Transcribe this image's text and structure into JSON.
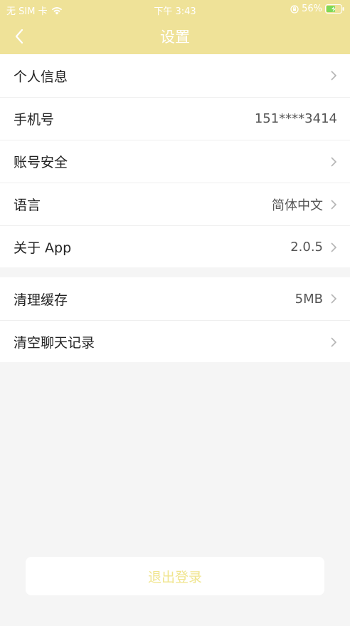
{
  "status": {
    "carrier": "无 SIM 卡",
    "time": "下午 3:43",
    "battery": "56%"
  },
  "nav": {
    "title": "设置"
  },
  "group1": [
    {
      "label": "个人信息",
      "value": ""
    },
    {
      "label": "手机号",
      "value": "151****3414"
    },
    {
      "label": "账号安全",
      "value": ""
    },
    {
      "label": "语言",
      "value": "简体中文"
    },
    {
      "label": "关于 App",
      "value": "2.0.5"
    }
  ],
  "group2": [
    {
      "label": "清理缓存",
      "value": "5MB"
    },
    {
      "label": "清空聊天记录",
      "value": ""
    }
  ],
  "logout": {
    "label": "退出登录"
  },
  "colors": {
    "header": "#efe298",
    "logout_text": "#f0e58f"
  },
  "icons": [
    "wifi-icon",
    "orientation-lock-icon",
    "battery-icon",
    "back-arrow-icon",
    "chevron-right-icon"
  ]
}
